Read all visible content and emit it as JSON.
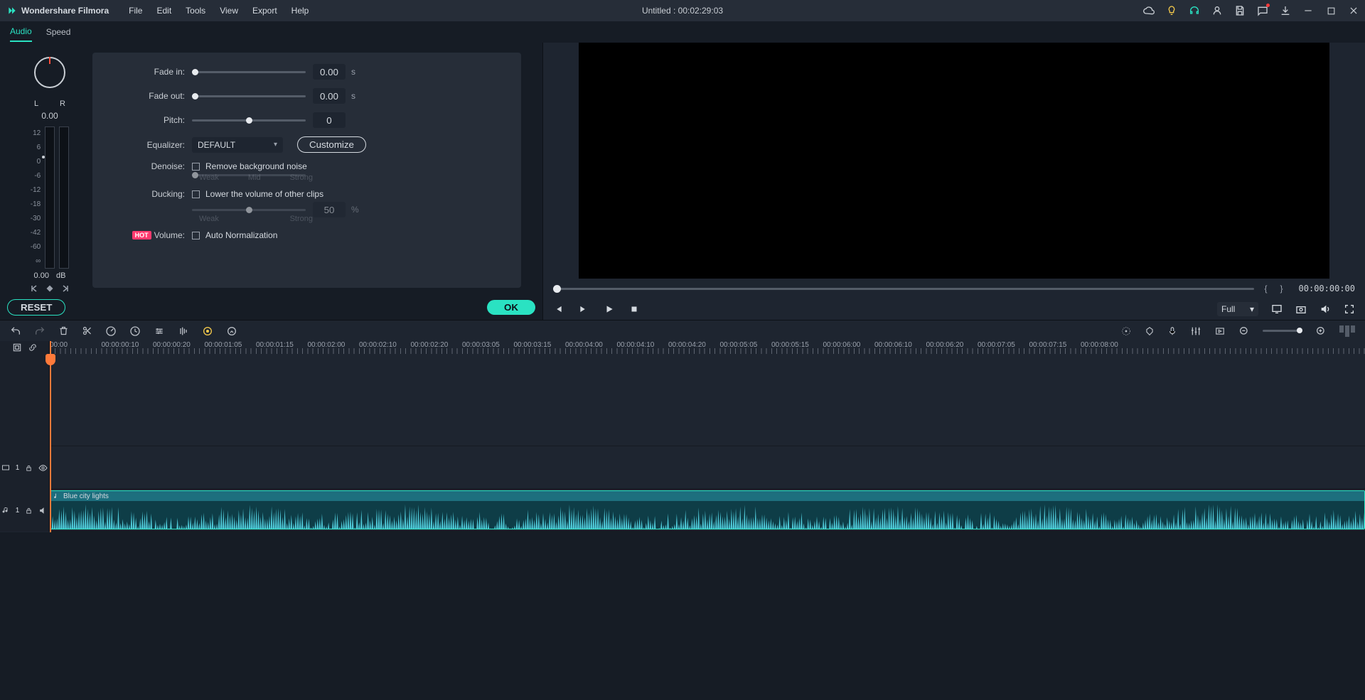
{
  "app_name": "Wondershare Filmora",
  "menu": [
    "File",
    "Edit",
    "Tools",
    "View",
    "Export",
    "Help"
  ],
  "title_center": "Untitled : 00:02:29:03",
  "tabs": {
    "audio": "Audio",
    "speed": "Speed"
  },
  "knob": {
    "left": "L",
    "right": "R",
    "value": "0.00"
  },
  "vu": {
    "scale": [
      "12",
      "6",
      "0",
      "-6",
      "-12",
      "-18",
      "-30",
      "-42",
      "-60",
      "∞"
    ],
    "value": "0.00",
    "unit": "dB"
  },
  "form": {
    "fade_in": {
      "label": "Fade in:",
      "value": "0.00",
      "unit": "s"
    },
    "fade_out": {
      "label": "Fade out:",
      "value": "0.00",
      "unit": "s"
    },
    "pitch": {
      "label": "Pitch:",
      "value": "0"
    },
    "equalizer": {
      "label": "Equalizer:",
      "value": "DEFAULT",
      "button": "Customize"
    },
    "denoise": {
      "label": "Denoise:",
      "check": "Remove background noise",
      "weak": "Weak",
      "mid": "Mid",
      "strong": "Strong"
    },
    "ducking": {
      "label": "Ducking:",
      "check": "Lower the volume of other clips",
      "value": "50",
      "unit": "%",
      "weak": "Weak",
      "strong": "Strong"
    },
    "volume": {
      "hot": "HOT",
      "label": "Volume:",
      "check": "Auto Normalization"
    }
  },
  "actions": {
    "reset": "RESET",
    "ok": "OK"
  },
  "preview": {
    "time": "00:00:00:00",
    "quality": "Full"
  },
  "ruler": [
    "00:00",
    "00:00:00:10",
    "00:00:00:20",
    "00:00:01:05",
    "00:00:01:15",
    "00:00:02:00",
    "00:00:02:10",
    "00:00:02:20",
    "00:00:03:05",
    "00:00:03:15",
    "00:00:04:00",
    "00:00:04:10",
    "00:00:04:20",
    "00:00:05:05",
    "00:00:05:15",
    "00:00:06:00",
    "00:00:06:10",
    "00:00:06:20",
    "00:00:07:05",
    "00:00:07:15",
    "00:00:08:00"
  ],
  "video_track_label": "1",
  "audio_track_label": "1",
  "clip": {
    "name": "Blue city lights"
  }
}
